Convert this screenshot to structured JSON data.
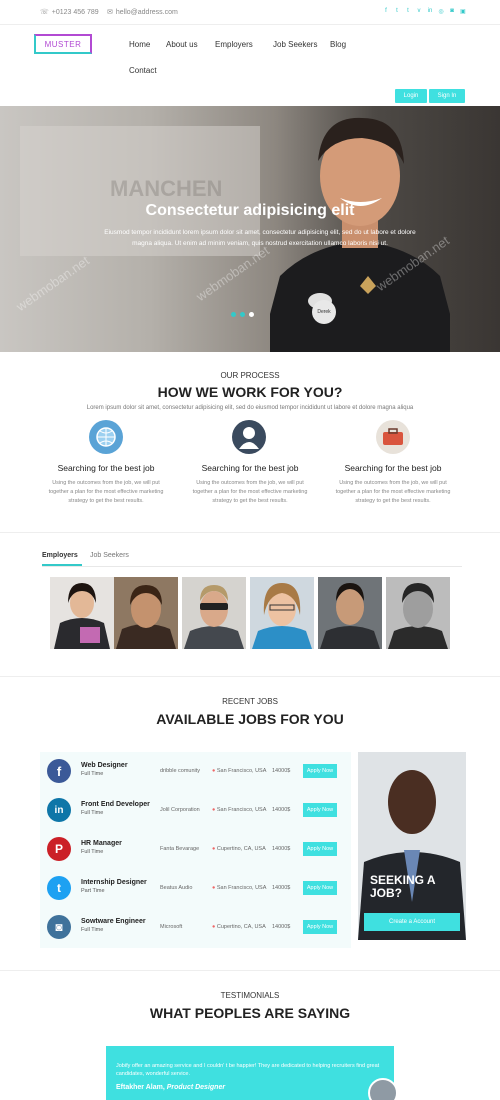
{
  "topbar": {
    "phone": "+0123 456 789",
    "email": "hello@address.com",
    "socials": [
      "f",
      "t",
      "t",
      "v",
      "in",
      "◎",
      "◙",
      "▣"
    ]
  },
  "header": {
    "logo": "MUSTER",
    "nav": [
      "Home",
      "About us",
      "Employers",
      "Job Seekers",
      "Blog",
      "Contact"
    ],
    "login": "Login",
    "signin": "Sign In"
  },
  "hero": {
    "title": "Consectetur adipisicing elit",
    "subtitle": "Eiusmod tempor incididunt lorem ipsum dolor sit amet, consectetur adipisicing elit, sed do ut labore et dolore magna aliqua. Ut enim ad minim veniam, quis nostrud exercitation ullamco laboris nisi ut.",
    "badge": "Derek",
    "watermark": "webmoban.net"
  },
  "process": {
    "eyebrow": "OUR PROCESS",
    "title": "HOW WE WORK FOR YOU?",
    "desc": "Lorem ipsum dolor sit amet, consectetur adipisicing elit, sed do eiusmod tempor incididunt ut labore et dolore magna aliqua",
    "cards": [
      {
        "title": "Searching for the best job",
        "text": "Using the outcomes from the job, we will put together a plan for the most effective marketing strategy to get the best results.",
        "icon": "globe-icon",
        "color": "#5aa3d6"
      },
      {
        "title": "Searching for the best job",
        "text": "Using the outcomes from the job, we will put together a plan for the most effective marketing strategy to get the best results.",
        "icon": "user-icon",
        "color": "#3a4a5e"
      },
      {
        "title": "Searching for the best job",
        "text": "Using the outcomes from the job, we will put together a plan for the most effective marketing strategy to get the best results.",
        "icon": "briefcase-icon",
        "color": "#e8e2da"
      }
    ]
  },
  "tabs": {
    "employers": "Employers",
    "seekers": "Job Seekers"
  },
  "jobs": {
    "eyebrow": "RECENT JOBS",
    "title": "AVAILABLE JOBS FOR YOU",
    "apply": "Apply Now",
    "rows": [
      {
        "title": "Web Designer",
        "type": "Full Time",
        "company": "dribble comunity",
        "location": "San Francisco, USA",
        "salary": "14000$",
        "icon": "facebook-icon",
        "color": "#3b5998",
        "glyph": "f"
      },
      {
        "title": "Front End Developer",
        "type": "Full Time",
        "company": "Jolil Corporation",
        "location": "San Francisco, USA",
        "salary": "14000$",
        "icon": "linkedin-icon",
        "color": "#0e76a8",
        "glyph": "in"
      },
      {
        "title": "HR Manager",
        "type": "Full Time",
        "company": "Fanta Bevarage",
        "location": "Cupertino, CA, USA",
        "salary": "14000$",
        "icon": "pinterest-icon",
        "color": "#cb2027",
        "glyph": "P"
      },
      {
        "title": "Internship Designer",
        "type": "Part Time",
        "company": "Beatus Audio",
        "location": "San Francisco, USA",
        "salary": "14000$",
        "icon": "twitter-icon",
        "color": "#1da1f2",
        "glyph": "t"
      },
      {
        "title": "Sowtware Engineer",
        "type": "Full Time",
        "company": "Microsoft",
        "location": "Cupertino, CA, USA",
        "salary": "14000$",
        "icon": "instagram-icon",
        "color": "#3f729b",
        "glyph": "◙"
      }
    ],
    "seeking": "SEEKING A JOB?",
    "create": "Create a Account"
  },
  "testimonials": {
    "eyebrow": "TESTIMONIALS",
    "title": "WHAT PEOPLES ARE SAYING",
    "quote": "Jobify offer an amazing service and I couldn' t be happier! They are dedicated to helping recruiters find great candidates, wonderful service.",
    "author": "Eftakher Alam,",
    "role": "Product Designer"
  },
  "colors": {
    "accent": "#3fe0e0",
    "logo": "#b24ad3"
  }
}
